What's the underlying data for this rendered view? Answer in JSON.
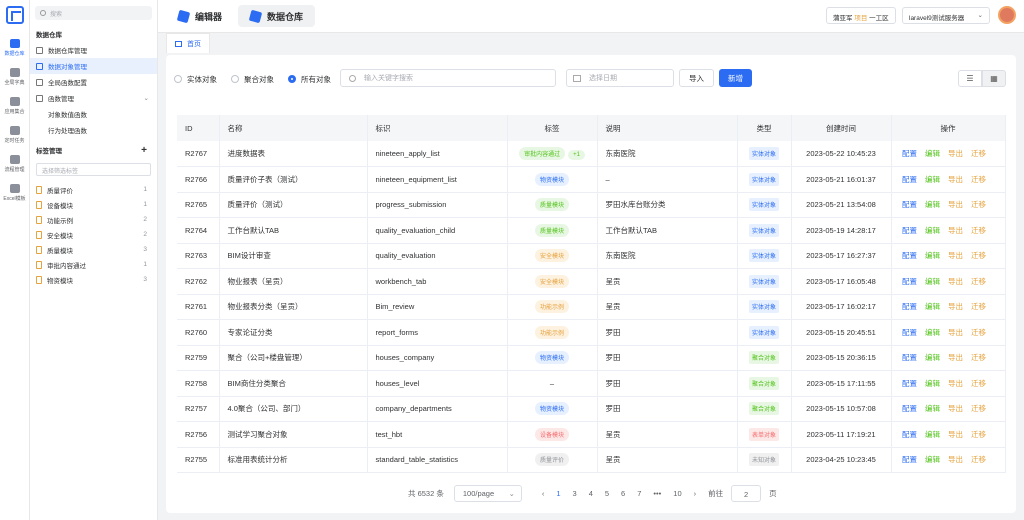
{
  "rail": [
    {
      "label": "数据仓库",
      "active": true
    },
    {
      "label": "全局字典"
    },
    {
      "label": "应用集合"
    },
    {
      "label": "定时任务"
    },
    {
      "label": "流程管理"
    },
    {
      "label": "Excel模板"
    }
  ],
  "sidebar": {
    "search_placeholder": "搜索",
    "section_warehouse": "数据仓库",
    "items": [
      {
        "label": "数据仓库管理"
      },
      {
        "label": "数据对象管理",
        "active": true
      },
      {
        "label": "全局函数配置"
      },
      {
        "label": "函数管理"
      }
    ],
    "sub_items": [
      {
        "label": "对象数值函数"
      },
      {
        "label": "行为处理函数"
      }
    ],
    "section_tags": "标签管理",
    "tag_add": "+",
    "tag_select_placeholder": "选择筛选标签",
    "tags": [
      {
        "label": "质量评价",
        "count": "1"
      },
      {
        "label": "设备模块",
        "count": "1"
      },
      {
        "label": "功能示例",
        "count": "2"
      },
      {
        "label": "安全模块",
        "count": "2"
      },
      {
        "label": "质量模块",
        "count": "3"
      },
      {
        "label": "审批内容通过",
        "count": "1"
      },
      {
        "label": "物资模块",
        "count": "3"
      }
    ]
  },
  "header": {
    "tabs": [
      {
        "label": "编辑器"
      },
      {
        "label": "数据仓库",
        "active": true
      }
    ],
    "user": "蒲亚军",
    "project_hl": "项目",
    "project": "一工区",
    "server": "laravel9测试服务器",
    "server_caret": "⌄"
  },
  "breadcrumb": {
    "label": "首页"
  },
  "toolbar": {
    "radios": [
      {
        "label": "实体对象"
      },
      {
        "label": "聚合对象"
      },
      {
        "label": "所有对象",
        "checked": true
      }
    ],
    "search_placeholder": "输入关键字搜索",
    "date_placeholder": "选择日期",
    "import_label": "导入",
    "add_label": "新增",
    "view_list": "☰",
    "view_grid": "▦"
  },
  "table": {
    "headers": [
      "ID",
      "名称",
      "标识",
      "标签",
      "说明",
      "类型",
      "创建时间",
      "操作"
    ],
    "ops": [
      "配置",
      "编辑",
      "导出",
      "迁移"
    ],
    "rows": [
      {
        "id": "R2767",
        "name": "进度数据表",
        "key": "nineteen_apply_list",
        "tag": "审批内容通过",
        "tag_extra": "+1",
        "tag_color": "green",
        "desc": "东南医院",
        "type": "实体对象",
        "type_color": "blue",
        "time": "2023-05-22 10:45:23"
      },
      {
        "id": "R2766",
        "name": "质量评价子表（测试）",
        "key": "nineteen_equipment_list",
        "tag": "物资模块",
        "tag_color": "blue",
        "desc": "–",
        "type": "实体对象",
        "type_color": "blue",
        "time": "2023-05-21 16:01:37"
      },
      {
        "id": "R2765",
        "name": "质量评价（测试）",
        "key": "progress_submission",
        "tag": "质量模块",
        "tag_color": "green",
        "desc": "罗田水库台账分类",
        "type": "实体对象",
        "type_color": "blue",
        "time": "2023-05-21 13:54:08"
      },
      {
        "id": "R2764",
        "name": "工作台默认TAB",
        "key": "quality_evaluation_child",
        "tag": "质量模块",
        "tag_color": "green",
        "desc": "工作台默认TAB",
        "type": "实体对象",
        "type_color": "blue",
        "time": "2023-05-19 14:28:17"
      },
      {
        "id": "R2763",
        "name": "BIM设计审查",
        "key": "quality_evaluation",
        "tag": "安全模块",
        "tag_color": "orange",
        "desc": "东南医院",
        "type": "实体对象",
        "type_color": "blue",
        "time": "2023-05-17 16:27:37"
      },
      {
        "id": "R2762",
        "name": "物业报表（呈贡）",
        "key": "workbench_tab",
        "tag": "安全模块",
        "tag_color": "orange",
        "desc": "呈贡",
        "type": "实体对象",
        "type_color": "blue",
        "time": "2023-05-17 16:05:48"
      },
      {
        "id": "R2761",
        "name": "物业报表分类（呈贡）",
        "key": "Bim_review",
        "tag": "功能示例",
        "tag_color": "orange",
        "desc": "呈贡",
        "type": "实体对象",
        "type_color": "blue",
        "time": "2023-05-17 16:02:17"
      },
      {
        "id": "R2760",
        "name": "专家论证分类",
        "key": "report_forms",
        "tag": "功能示例",
        "tag_color": "orange",
        "desc": "罗田",
        "type": "实体对象",
        "type_color": "blue",
        "time": "2023-05-15 20:45:51"
      },
      {
        "id": "R2759",
        "name": "聚合（公司+楼盘管理）",
        "key": "houses_company",
        "tag": "物资模块",
        "tag_color": "blue",
        "desc": "罗田",
        "type": "聚合对象",
        "type_color": "green",
        "time": "2023-05-15 20:36:15"
      },
      {
        "id": "R2758",
        "name": "BIM商住分类聚合",
        "key": "houses_level",
        "tag": "–",
        "tag_color": "none",
        "desc": "罗田",
        "type": "聚合对象",
        "type_color": "green",
        "time": "2023-05-15 17:11:55"
      },
      {
        "id": "R2757",
        "name": "4.0聚合（公司、部门）",
        "key": "company_departments",
        "tag": "物资模块",
        "tag_color": "blue",
        "desc": "罗田",
        "type": "聚合对象",
        "type_color": "green",
        "time": "2023-05-15 10:57:08"
      },
      {
        "id": "R2756",
        "name": "测试学习聚合对象",
        "key": "test_hbt",
        "tag": "设备模块",
        "tag_color": "red",
        "desc": "呈贡",
        "type": "表单对象",
        "type_color": "red",
        "time": "2023-05-11 17:19:21"
      },
      {
        "id": "R2755",
        "name": "标准用表统计分析",
        "key": "standard_table_statistics",
        "tag": "质量评价",
        "tag_color": "gray",
        "desc": "呈贡",
        "type": "未知对象",
        "type_color": "gray",
        "time": "2023-04-25 10:23:45"
      }
    ]
  },
  "pagination": {
    "total": "共 6532 条",
    "page_size": "100/page",
    "prev": "‹",
    "pages": [
      "1",
      "3",
      "4",
      "5",
      "6",
      "7",
      "•••",
      "10"
    ],
    "current": "1",
    "next": "›",
    "goto_label": "前往",
    "goto_value": "2",
    "page_unit": "页"
  },
  "colors": {
    "accent": "#2b6cf2",
    "green": "#52c41a",
    "orange": "#e6a23c",
    "red": "#f56c6c"
  }
}
